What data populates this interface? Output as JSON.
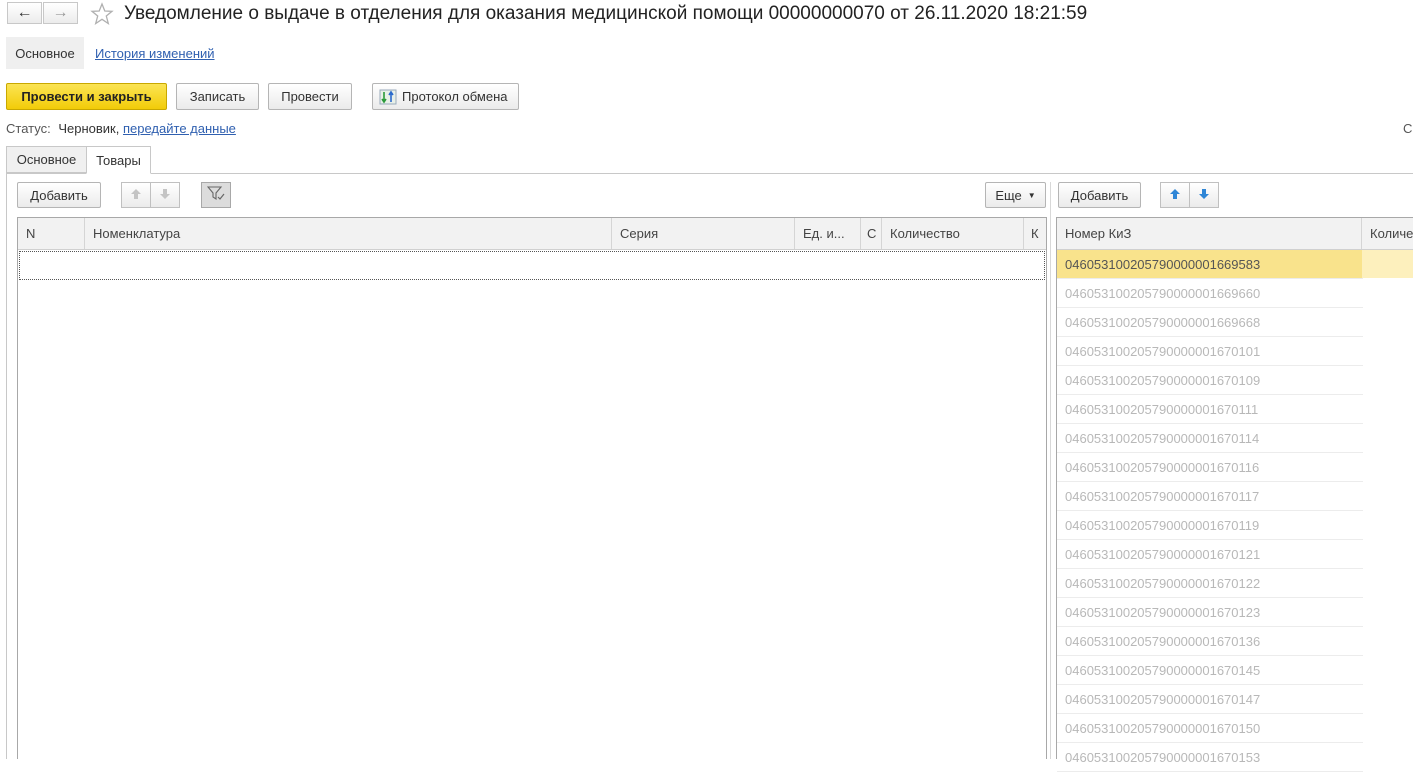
{
  "header": {
    "title": "Уведомление о выдаче в отделения для оказания медицинской помощи 00000000070 от 26.11.2020 18:21:59",
    "back_icon": "←",
    "forward_icon": "→"
  },
  "nav": {
    "main": "Основное",
    "history": "История изменений"
  },
  "toolbar": {
    "post_close": "Провести и закрыть",
    "save": "Записать",
    "post": "Провести",
    "exchange_log": "Протокол обмена"
  },
  "status": {
    "label": "Статус:",
    "value": "Черновик,",
    "link": "передайте данные",
    "right_edge": "С"
  },
  "tabs": [
    "Основное",
    "Товары"
  ],
  "left_panel": {
    "add": "Добавить",
    "more": "Еще",
    "columns": [
      "N",
      "Номенклатура",
      "Серия",
      "Ед. и...",
      "С",
      "Количество",
      "К"
    ]
  },
  "right_panel": {
    "add": "Добавить",
    "columns": [
      "Номер КиЗ",
      "Количе"
    ],
    "rows": [
      "04605310020579000000 1669583",
      "046053100205790000001669660",
      "046053100205790000001669668",
      "046053100205790000001670101",
      "046053100205790000001670109",
      "046053100205790000001670111",
      "046053100205790000001670114",
      "046053100205790000001670116",
      "046053100205790000001670117",
      "046053100205790000001670119",
      "046053100205790000001670121",
      "046053100205790000001670122",
      "046053100205790000001670123",
      "046053100205790000001670136",
      "046053100205790000001670145",
      "046053100205790000001670147",
      "046053100205790000001670150",
      "046053100205790000001670153"
    ]
  },
  "colors": {
    "primary_button": "#f2cc08",
    "selected_row": "#f9e38c",
    "link": "#3060b0"
  }
}
